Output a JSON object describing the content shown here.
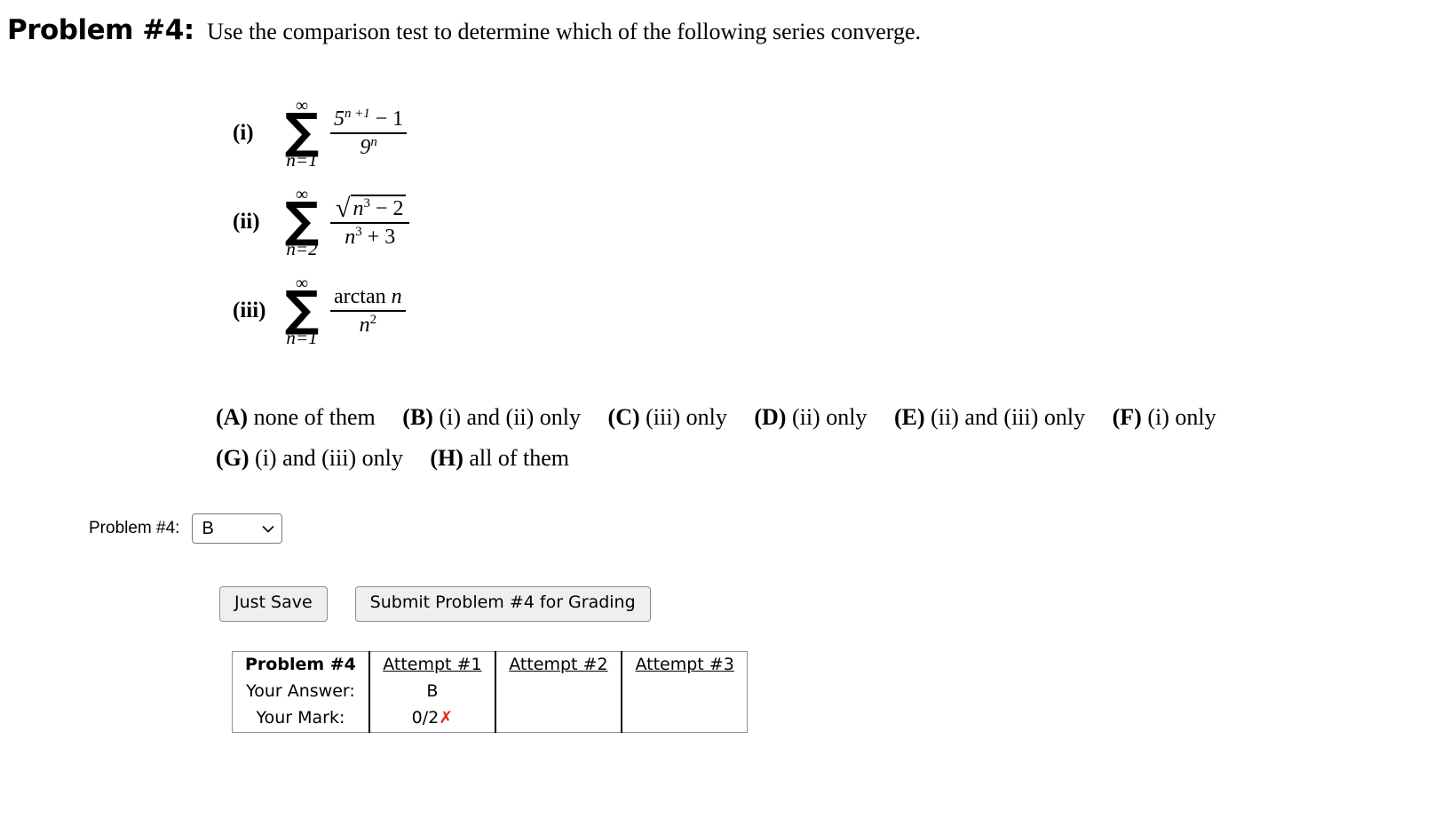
{
  "header": {
    "problem_label": "Problem #4:",
    "prompt": "Use the comparison test to determine which of the following series converge."
  },
  "series": [
    {
      "tag": "(i)",
      "sigma": "∑",
      "upper": "∞",
      "lower": "n=1",
      "numerator_parts": {
        "base": "5",
        "exp": "n +1",
        "tail": "− 1"
      },
      "denominator_parts": {
        "base": "9",
        "exp": "n"
      },
      "plain": "sum n=1 to infinity of (5^(n+1) - 1) / 9^n"
    },
    {
      "tag": "(ii)",
      "sigma": "∑",
      "upper": "∞",
      "lower": "n=2",
      "numerator_parts": {
        "radical": "√",
        "inner_base": "n",
        "inner_exp": "3",
        "inner_tail": "− 2"
      },
      "denominator_parts": {
        "base": "n",
        "exp": "3",
        "tail": "+ 3"
      },
      "plain": "sum n=2 to infinity of sqrt(n^3 - 2) / (n^3 + 3)"
    },
    {
      "tag": "(iii)",
      "sigma": "∑",
      "upper": "∞",
      "lower": "n=1",
      "numerator_parts": {
        "func": "arctan",
        "arg": "n"
      },
      "denominator_parts": {
        "base": "n",
        "exp": "2"
      },
      "plain": "sum n=1 to infinity of arctan(n) / n^2"
    }
  ],
  "options": {
    "line1": [
      {
        "letter": "(A)",
        "text": "none of them"
      },
      {
        "letter": "(B)",
        "text": "(i) and (ii) only"
      },
      {
        "letter": "(C)",
        "text": "(iii) only"
      },
      {
        "letter": "(D)",
        "text": "(ii) only"
      },
      {
        "letter": "(E)",
        "text": "(ii) and (iii) only"
      },
      {
        "letter": "(F)",
        "text": "(i) only"
      }
    ],
    "line2": [
      {
        "letter": "(G)",
        "text": "(i) and (iii) only"
      },
      {
        "letter": "(H)",
        "text": "all of them"
      }
    ]
  },
  "answer": {
    "label": "Problem #4:",
    "selected": "B",
    "choices": [
      "A",
      "B",
      "C",
      "D",
      "E",
      "F",
      "G",
      "H"
    ]
  },
  "buttons": {
    "just_save": "Just Save",
    "submit": "Submit Problem #4 for Grading"
  },
  "results_table": {
    "corner": "Problem #4",
    "columns": [
      "Attempt #1",
      "Attempt #2",
      "Attempt #3"
    ],
    "rows": [
      {
        "label": "Your Answer:",
        "cells": [
          "B",
          "",
          ""
        ]
      },
      {
        "label": "Your Mark:",
        "cells": [
          "0/2",
          "",
          ""
        ],
        "marks": [
          "✗",
          "",
          ""
        ]
      }
    ]
  },
  "colors": {
    "wrong_mark": "#e8231a",
    "button_face": "#efefef",
    "border": "#909090"
  }
}
